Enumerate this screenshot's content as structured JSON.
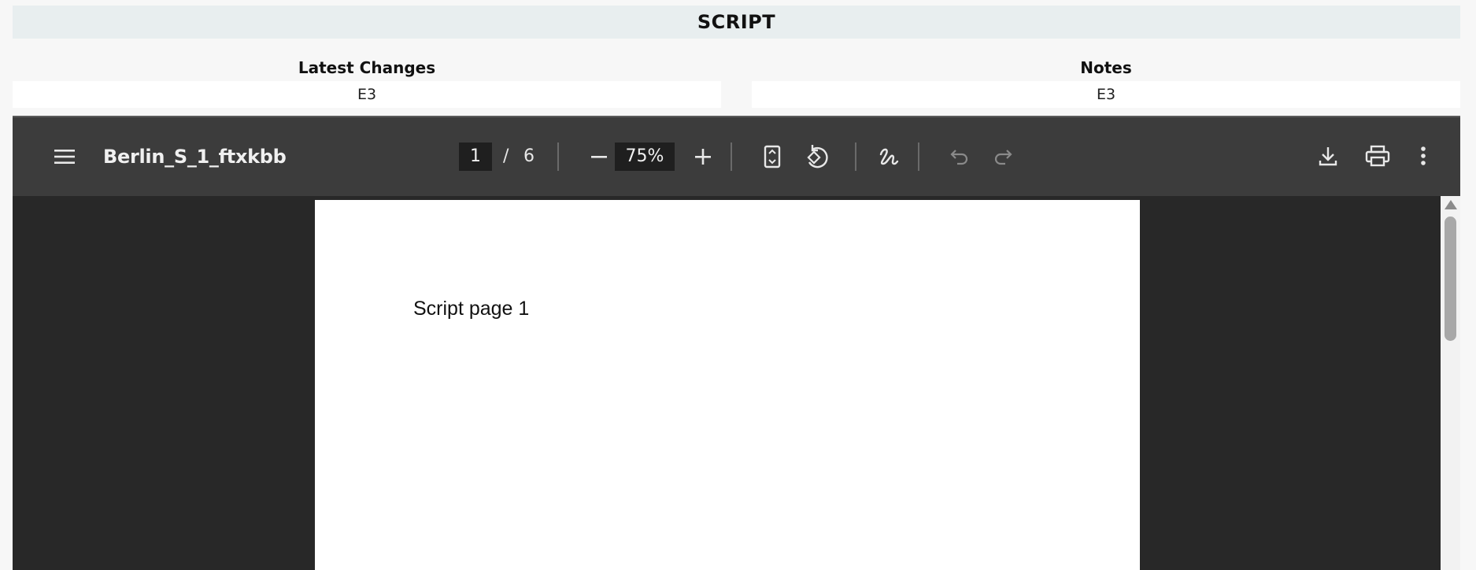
{
  "header": {
    "title": "SCRIPT"
  },
  "fields": {
    "latest_changes": {
      "label": "Latest Changes",
      "value": "E3"
    },
    "notes": {
      "label": "Notes",
      "value": "E3"
    }
  },
  "viewer": {
    "title": "Berlin_S_1_ftxkbb",
    "current_page": "1",
    "page_separator": "/",
    "total_pages": "6",
    "zoom": "75%",
    "page_text": "Script page 1",
    "icons": {
      "menu": "menu-icon",
      "zoom_out": "minus-icon",
      "zoom_in": "plus-icon",
      "fit": "fit-page-icon",
      "rotate": "rotate-icon",
      "annotate": "draw-icon",
      "undo": "undo-icon",
      "redo": "redo-icon",
      "download": "download-icon",
      "print": "print-icon",
      "more": "more-vert-icon"
    },
    "colors": {
      "toolbar": "#3c3c3c",
      "background": "#282828",
      "input_bg": "#1f1f1f",
      "disabled_icon": "#8a8a8a"
    }
  }
}
